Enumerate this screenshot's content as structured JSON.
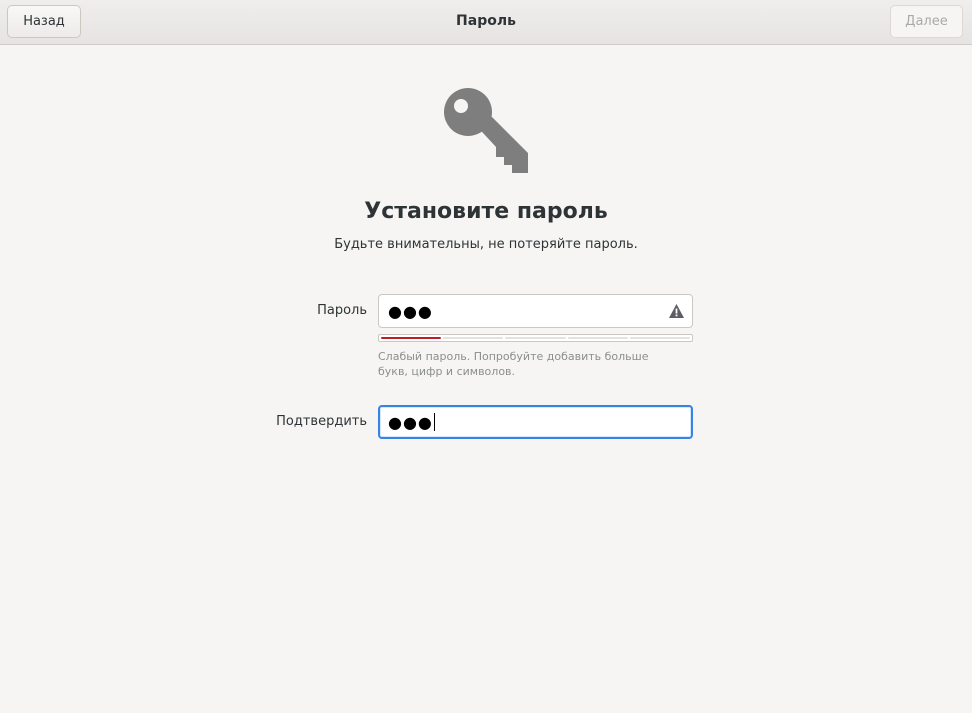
{
  "header": {
    "back_label": "Назад",
    "title": "Пароль",
    "next_label": "Далее"
  },
  "page": {
    "icon": "key-icon",
    "title": "Установите пароль",
    "subtitle": "Будьте внимательны, не потеряйте пароль."
  },
  "password": {
    "label": "Пароль",
    "value_masked": "●●●",
    "warning_icon": "warning-icon",
    "strength_level": 0.2,
    "strength_color": "#c01c28",
    "hint": "Слабый пароль. Попробуйте добавить больше букв, цифр и символов."
  },
  "confirm": {
    "label": "Подтвердить",
    "value_masked": "●●●",
    "focus_color": "#3584e4"
  }
}
